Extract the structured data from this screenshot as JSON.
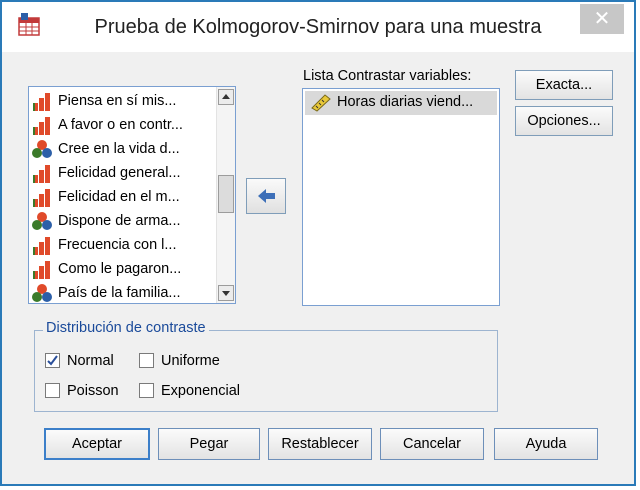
{
  "window": {
    "title": "Prueba de Kolmogorov-Smirnov para una muestra",
    "close_glyph": "✕"
  },
  "source_list": {
    "items": [
      {
        "label": "Piensa en sí mis...",
        "icon": "ordinal-bar-icon"
      },
      {
        "label": "A favor o en contr...",
        "icon": "ordinal-bar-icon"
      },
      {
        "label": "Cree en la vida d...",
        "icon": "nominal-circles-icon"
      },
      {
        "label": "Felicidad general...",
        "icon": "ordinal-bar-icon"
      },
      {
        "label": "Felicidad en el m...",
        "icon": "ordinal-bar-icon"
      },
      {
        "label": "Dispone de arma...",
        "icon": "nominal-circles-icon"
      },
      {
        "label": "Frecuencia con l...",
        "icon": "ordinal-bar-icon"
      },
      {
        "label": "Como le pagaron...",
        "icon": "ordinal-bar-icon"
      },
      {
        "label": "País de la familia...",
        "icon": "nominal-circles-icon"
      }
    ]
  },
  "target_list": {
    "label": "Lista Contrastar variables:",
    "items": [
      {
        "label": "Horas diarias viend...",
        "icon": "scale-ruler-icon"
      }
    ]
  },
  "side_buttons": {
    "exact": "Exacta...",
    "options": "Opciones..."
  },
  "distribution_group": {
    "legend": "Distribución de contraste",
    "normal": {
      "label": "Normal",
      "checked": true
    },
    "uniform": {
      "label": "Uniforme",
      "checked": false
    },
    "poisson": {
      "label": "Poisson",
      "checked": false
    },
    "exponential": {
      "label": "Exponencial",
      "checked": false
    }
  },
  "buttons": {
    "ok": "Aceptar",
    "paste": "Pegar",
    "reset": "Restablecer",
    "cancel": "Cancelar",
    "help": "Ayuda"
  },
  "colors": {
    "accent": "#2a7ab8",
    "legend_text": "#1a4a9a",
    "arrow_blue": "#3d6fb8"
  }
}
